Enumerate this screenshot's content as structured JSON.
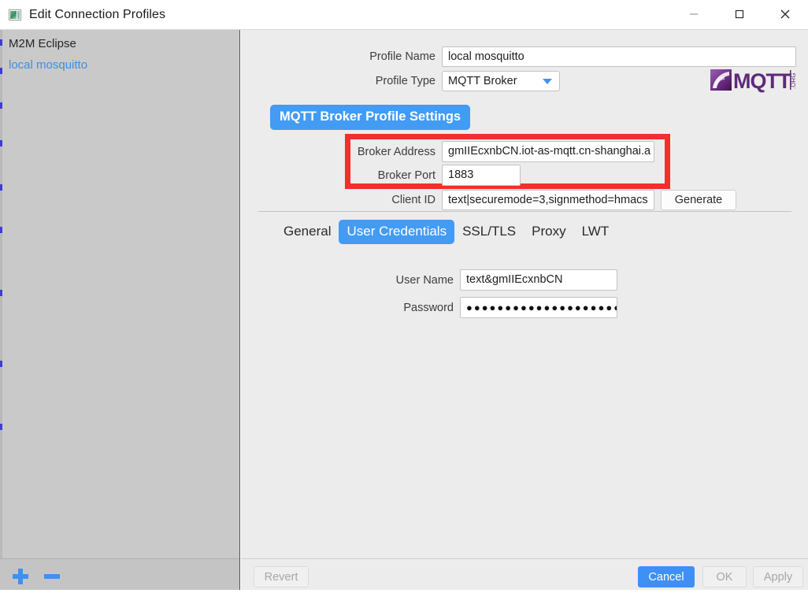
{
  "window": {
    "title": "Edit Connection Profiles",
    "icon": "app-window-icon",
    "minimize_label": "—",
    "maximize_label": "□",
    "close_label": "✕"
  },
  "sidebar": {
    "items": [
      {
        "label": "M2M Eclipse",
        "selected": false
      },
      {
        "label": "local mosquitto",
        "selected": true
      }
    ],
    "footer": {
      "add_label": "+",
      "remove_label": "−"
    }
  },
  "form": {
    "profile_name": {
      "label": "Profile Name",
      "value": "local mosquitto",
      "placeholder": ""
    },
    "profile_type": {
      "label": "Profile Type",
      "value": "MQTT Broker",
      "options": [
        "MQTT Broker"
      ]
    },
    "logo": {
      "wordmark": "MQTT",
      "suffix": ".ORG"
    },
    "section_title": "MQTT Broker Profile Settings",
    "broker_address": {
      "label": "Broker Address",
      "value": "gmIIEcxnbCN.iot-as-mqtt.cn-shanghai.a",
      "placeholder": ""
    },
    "broker_port": {
      "label": "Broker Port",
      "value": "1883",
      "placeholder": ""
    },
    "client_id": {
      "label": "Client ID",
      "value": "text|securemode=3,signmethod=hmacs",
      "placeholder": "",
      "generate_label": "Generate"
    }
  },
  "tabs": [
    {
      "label": "General",
      "active": false
    },
    {
      "label": "User Credentials",
      "active": true
    },
    {
      "label": "SSL/TLS",
      "active": false
    },
    {
      "label": "Proxy",
      "active": false
    },
    {
      "label": "LWT",
      "active": false
    }
  ],
  "credentials": {
    "user_name": {
      "label": "User Name",
      "value": "text&gmIIEcxnbCN",
      "placeholder": ""
    },
    "password": {
      "label": "Password",
      "value": "●●●●●●●●●●●●●●●●●●●●●",
      "placeholder": ""
    }
  },
  "footer": {
    "revert_label": "Revert",
    "cancel_label": "Cancel",
    "ok_label": "OK",
    "apply_label": "Apply"
  },
  "colors": {
    "accent_blue": "#3f90f5",
    "tab_active_blue": "#439bf3",
    "highlight_red": "#f42d2d",
    "link_blue": "#3c8ee8",
    "sidebar_gray": "#c9c9c9",
    "panel_gray": "#ececec",
    "logo_purple": "#6b2f86"
  }
}
